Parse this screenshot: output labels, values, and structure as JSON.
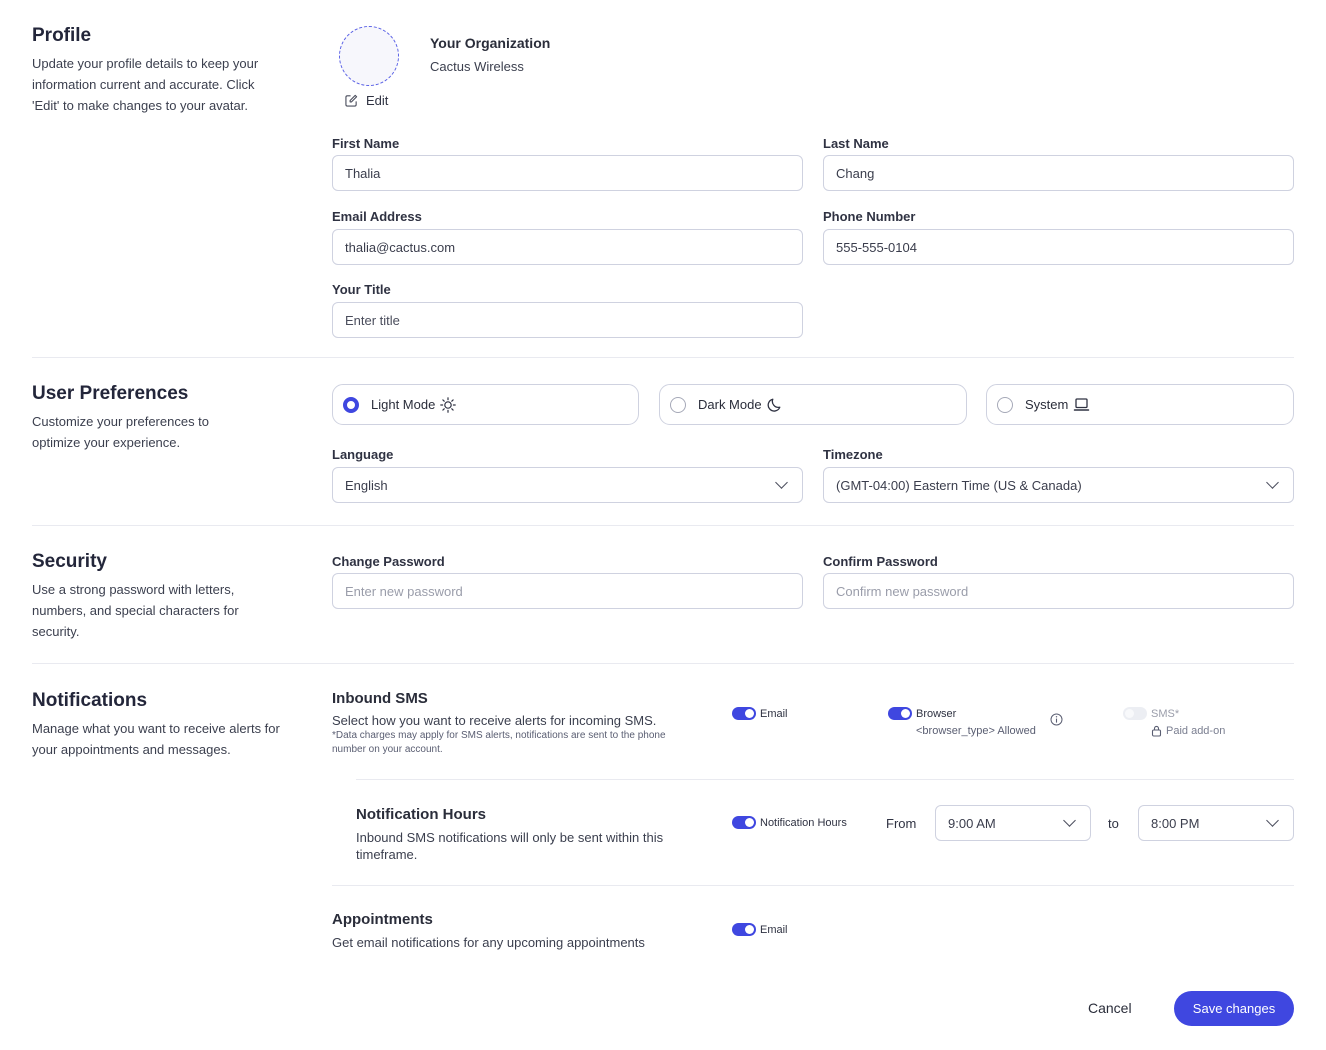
{
  "profile": {
    "title": "Profile",
    "desc": "Update your profile details to keep your information current and accurate. Click 'Edit' to make changes to your avatar.",
    "edit_label": "Edit",
    "org_title": "Your Organization",
    "org_name": "Cactus Wireless",
    "first_name_label": "First Name",
    "first_name_value": "Thalia",
    "last_name_label": "Last Name",
    "last_name_value": "Chang",
    "email_label": "Email Address",
    "email_value": "thalia@cactus.com",
    "phone_label": "Phone Number",
    "phone_value": "555-555-0104",
    "title_label": "Your Title",
    "title_placeholder": "Enter title"
  },
  "preferences": {
    "title": "User Preferences",
    "desc": "Customize your preferences to optimize your experience.",
    "modes": [
      {
        "label": "Light Mode",
        "selected": true,
        "icon": "sun-icon"
      },
      {
        "label": "Dark Mode",
        "selected": false,
        "icon": "moon-icon"
      },
      {
        "label": "System",
        "selected": false,
        "icon": "laptop-icon"
      }
    ],
    "language_label": "Language",
    "language_value": "English",
    "timezone_label": "Timezone",
    "timezone_value": "(GMT-04:00) Eastern Time (US & Canada)"
  },
  "security": {
    "title": "Security",
    "desc": "Use a strong password with letters, numbers, and special characters for security.",
    "change_label": "Change Password",
    "change_placeholder": "Enter new password",
    "confirm_label": "Confirm Password",
    "confirm_placeholder": "Confirm new password"
  },
  "notifications": {
    "title": "Notifications",
    "desc": "Manage what you want to receive alerts for your appointments and messages.",
    "inbound": {
      "title": "Inbound SMS",
      "desc": "Select how you want to receive alerts for incoming SMS.",
      "note": "*Data charges may apply for SMS alerts, notifications are sent to the phone number on your account.",
      "email_label": "Email",
      "browser_label": "Browser",
      "browser_sub": "<browser_type> Allowed",
      "sms_label": "SMS*",
      "sms_sub": "Paid add-on"
    },
    "hours": {
      "title": "Notification Hours",
      "desc": "Inbound SMS notifications will only be sent within this timeframe.",
      "toggle_label": "Notification Hours",
      "from_label": "From",
      "from_value": "9:00 AM",
      "to_label": "to",
      "to_value": "8:00 PM"
    },
    "appointments": {
      "title": "Appointments",
      "desc": "Get email notifications for any upcoming appointments",
      "email_label": "Email"
    }
  },
  "footer": {
    "cancel_label": "Cancel",
    "save_label": "Save changes"
  },
  "colors": {
    "accent": "#3f47e0",
    "border": "#cfd2e0"
  }
}
